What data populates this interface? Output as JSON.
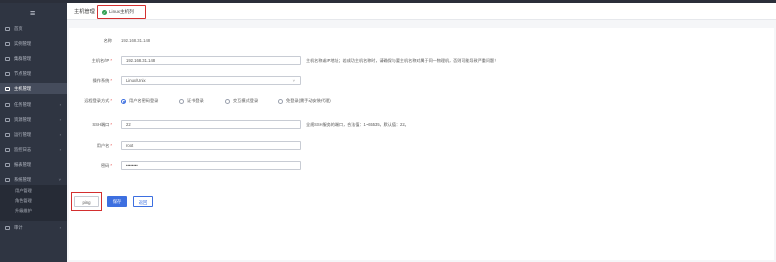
{
  "sidebar": {
    "toggle_icon": "menu-icon",
    "items": [
      {
        "label": "首页",
        "icon": "home-icon",
        "has_arrow": false
      },
      {
        "label": "实例管理",
        "icon": "instance-icon",
        "has_arrow": false
      },
      {
        "label": "集群管理",
        "icon": "cluster-icon",
        "has_arrow": false
      },
      {
        "label": "节点管理",
        "icon": "node-icon",
        "has_arrow": false
      },
      {
        "label": "主机管理",
        "icon": "host-icon",
        "has_arrow": false,
        "active": true
      },
      {
        "label": "任务管理",
        "icon": "task-icon",
        "has_arrow": true
      },
      {
        "label": "资源管理",
        "icon": "resource-icon",
        "has_arrow": true
      },
      {
        "label": "运行管理",
        "icon": "ops-icon",
        "has_arrow": true
      },
      {
        "label": "监控日志",
        "icon": "monitor-icon",
        "has_arrow": true
      },
      {
        "label": "报表管理",
        "icon": "report-icon",
        "has_arrow": false
      },
      {
        "label": "系统管理",
        "icon": "settings-icon",
        "has_arrow": true
      }
    ],
    "sub_items": [
      "用户管理",
      "角色管理",
      "升级维护"
    ],
    "last_item": {
      "label": "审计",
      "icon": "audit-icon",
      "has_arrow": true
    }
  },
  "header": {
    "breadcrumb": "主机管理",
    "tab_label": "Linux主机列",
    "tab_icon": "check-circle-icon"
  },
  "form": {
    "hostname": {
      "label": "名称",
      "value": "192.168.31.148"
    },
    "ip": {
      "label": "主机名/IP",
      "value": "192.168.31.148",
      "hint": "主机名称或IP地址；若成功主机名称时，请确保与要主机名称对属于同一物理机，否则可能导致严重问题！"
    },
    "os": {
      "label": "操作系统",
      "value": "Linux/Unix"
    },
    "auth": {
      "label": "远程登录方式",
      "options": [
        "用户名密码登录",
        "证书登录",
        "交互模式登录",
        "免登录(需手动安装代理)"
      ],
      "selected": 0
    },
    "port": {
      "label": "SSH端口",
      "value": "22",
      "hint": "全规SSH服务的端口，合法值：1~65535，默认值：22。"
    },
    "user": {
      "label": "用户名",
      "value": "root"
    },
    "password": {
      "label": "密码",
      "value": "••••••••"
    }
  },
  "actions": {
    "ping": "ping",
    "save": "保存",
    "back": "返回"
  },
  "colors": {
    "sidebar_bg": "#2f3542",
    "primary": "#3d6fe0",
    "highlight": "#d32f2f",
    "success": "#2e9e4f"
  }
}
